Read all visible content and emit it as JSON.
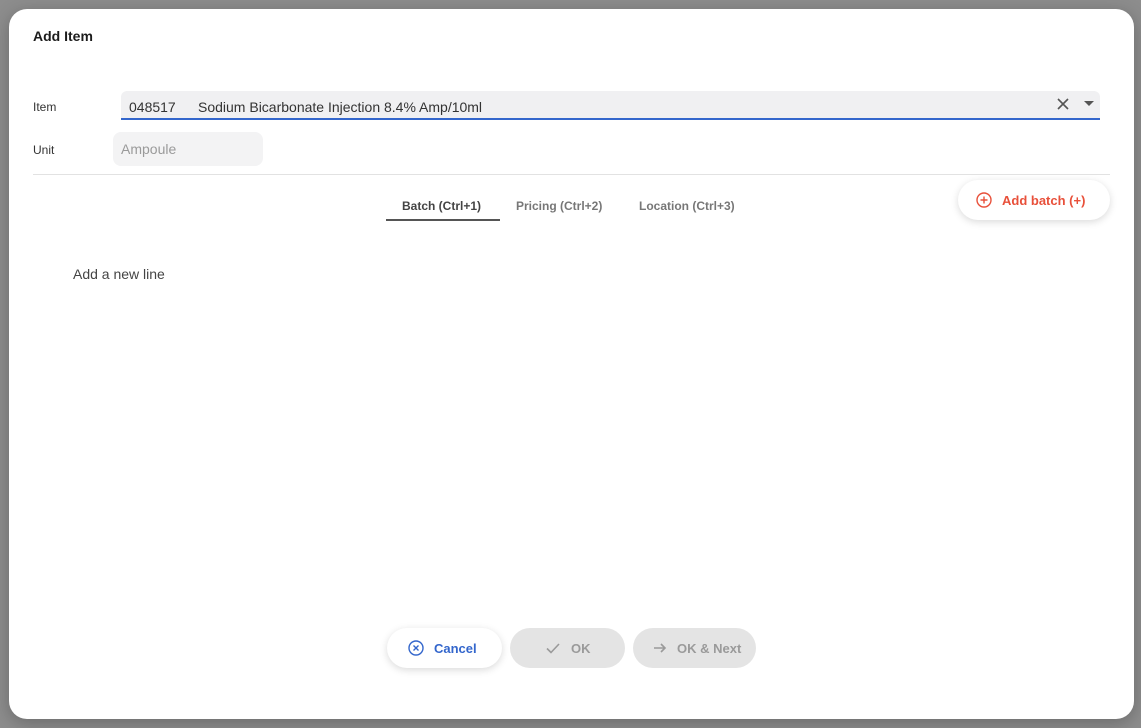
{
  "dialog": {
    "title": "Add Item"
  },
  "form": {
    "item_label": "Item",
    "item_code": "048517",
    "item_name": "Sodium Bicarbonate Injection 8.4% Amp/10ml",
    "unit_label": "Unit",
    "unit_value": "Ampoule"
  },
  "tabs": [
    {
      "label": "Batch (Ctrl+1)",
      "active": true
    },
    {
      "label": "Pricing (Ctrl+2)",
      "active": false
    },
    {
      "label": "Location (Ctrl+3)",
      "active": false
    }
  ],
  "toolbar": {
    "add_batch_label": "Add batch (+)"
  },
  "table": {
    "empty_text": "Add a new line"
  },
  "footer": {
    "cancel_label": "Cancel",
    "ok_label": "OK",
    "ok_next_label": "OK & Next"
  },
  "colors": {
    "accent_blue": "#3366cc",
    "accent_red": "#e8503a",
    "disabled_bg": "#e4e4e4"
  }
}
